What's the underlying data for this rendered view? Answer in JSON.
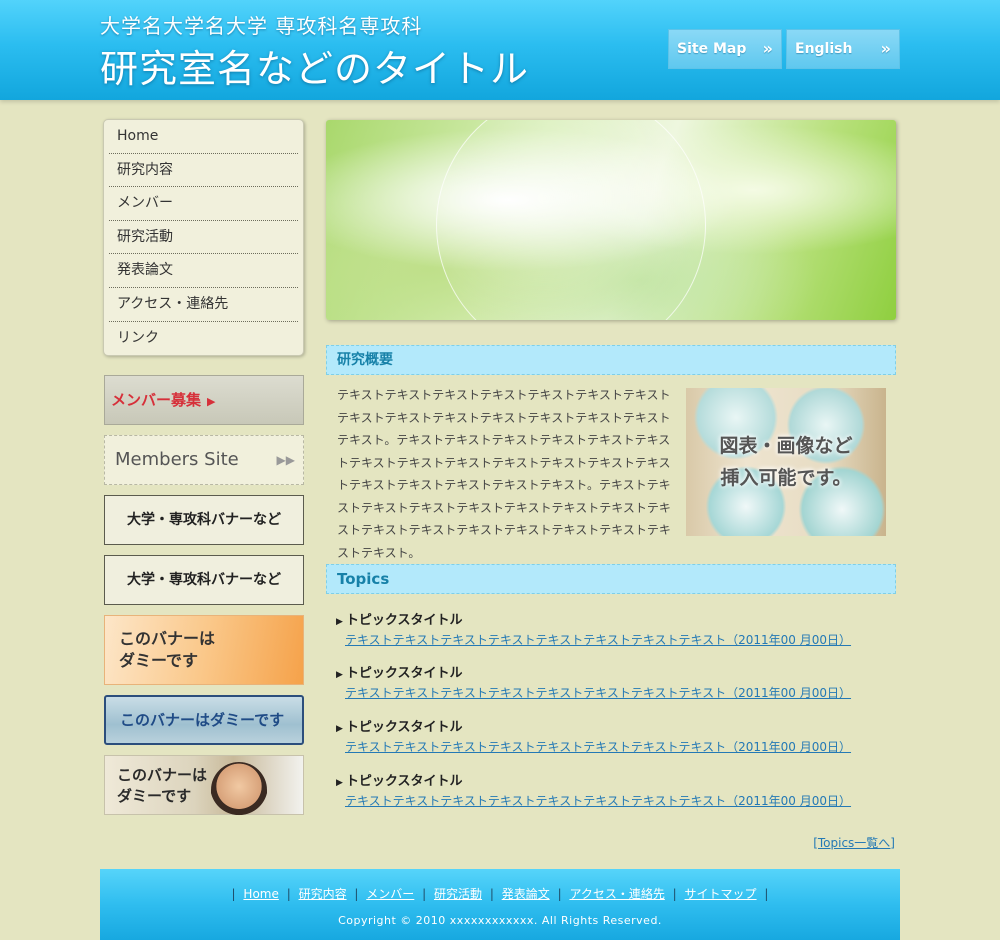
{
  "header": {
    "university": "大学名大学名大学 専攻科名専攻科",
    "lab_title": "研究室名などのタイトル",
    "site_map": "Site Map",
    "english": "English",
    "arrow": "»"
  },
  "nav": {
    "items": [
      "Home",
      "研究内容",
      "メンバー",
      "研究活動",
      "発表論文",
      "アクセス・連絡先",
      "リンク"
    ]
  },
  "banners": {
    "recruit": "メンバー募集",
    "recruit_arrow": "▶",
    "members_site": "Members Site",
    "members_arrow": "▶▶",
    "univ_banner_1": "大学・専攻科バナーなど",
    "univ_banner_2": "大学・専攻科バナーなど",
    "dummy1_line1": "このバナーは",
    "dummy1_line2": "ダミーです",
    "dummy2": "このバナーはダミーです",
    "dummy3_line1": "このバナーは",
    "dummy3_line2": "ダミーです"
  },
  "overview": {
    "heading": "研究概要",
    "text": "テキストテキストテキストテキストテキストテキストテキストテキストテキストテキストテキストテキストテキストテキストテキスト。テキストテキストテキストテキストテキストテキストテキストテキストテキストテキストテキストテキストテキストテキストテキストテキストテキストテキスト。テキストテキストテキストテキストテキストテキストテキストテキストテキストテキストテキストテキストテキストテキストテキストテキストテキスト。",
    "photo_line1": "図表・画像など",
    "photo_line2": "挿入可能です。"
  },
  "topics": {
    "heading": "Topics",
    "items": [
      {
        "title": "トピックスタイトル",
        "link": "テキストテキストテキストテキストテキストテキストテキストテキスト（2011年00 月00日）"
      },
      {
        "title": "トピックスタイトル",
        "link": "テキストテキストテキストテキストテキストテキストテキストテキスト（2011年00 月00日）"
      },
      {
        "title": "トピックスタイトル",
        "link": "テキストテキストテキストテキストテキストテキストテキストテキスト（2011年00 月00日）"
      },
      {
        "title": "トピックスタイトル",
        "link": "テキストテキストテキストテキストテキストテキストテキストテキスト（2011年00 月00日）"
      }
    ],
    "bullet": "▶",
    "more": "[Topics一覧へ]"
  },
  "footer": {
    "links": [
      "Home",
      "研究内容",
      "メンバー",
      "研究活動",
      "発表論文",
      "アクセス・連絡先",
      "サイトマップ"
    ],
    "separator": "|",
    "copyright": "Copyright © 2010 xxxxxxxxxxxx. All Rights Reserved."
  }
}
